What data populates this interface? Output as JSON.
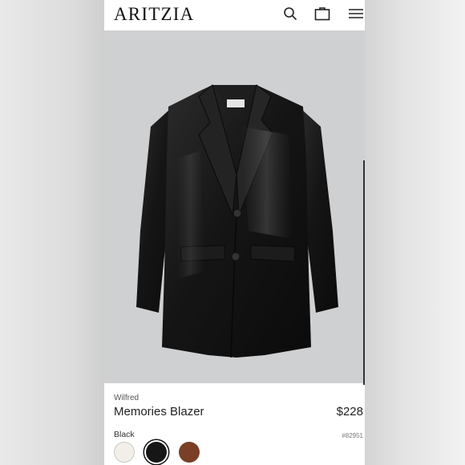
{
  "header": {
    "logo": "ARITZIA",
    "icons": [
      "search-icon",
      "bag-icon",
      "menu-icon"
    ]
  },
  "product": {
    "brand": "Wilfred",
    "name": "Memories Blazer",
    "price": "$228",
    "sku": "#82951",
    "selected_color": "Black",
    "swatches": [
      {
        "name": "cream",
        "color": "#f1efe8"
      },
      {
        "name": "black",
        "color": "#161616",
        "selected": true
      },
      {
        "name": "brown",
        "color": "#7a3f26"
      }
    ]
  },
  "colors": {
    "background": "#ffffff",
    "image_background": "#cfd0d1",
    "text": "#222222"
  }
}
